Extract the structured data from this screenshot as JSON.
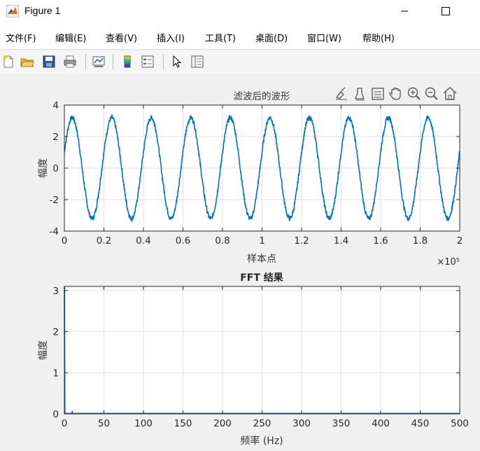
{
  "window": {
    "title": "Figure 1"
  },
  "menu": [
    "文件(F)",
    "编辑(E)",
    "查看(V)",
    "插入(I)",
    "工具(T)",
    "桌面(D)",
    "窗口(W)",
    "帮助(H)"
  ],
  "toolbar": [
    "new-figure-icon",
    "open-icon",
    "save-icon",
    "print-icon",
    "link-plot-icon",
    "colorbar-icon",
    "legend-icon",
    "pointer-icon",
    "property-inspector-icon"
  ],
  "axes_toolbar": [
    "brush-icon",
    "data-tips-icon",
    "rotate-icon",
    "pan-icon",
    "zoom-in-icon",
    "zoom-out-icon",
    "home-icon"
  ],
  "chart_data": [
    {
      "type": "line",
      "title": "滤波后的波形",
      "xlabel": "样本点",
      "ylabel": "幅度",
      "x_multiplier": "×10⁵",
      "xlim": [
        0,
        2
      ],
      "ylim": [
        -4,
        4
      ],
      "xticks": [
        "0",
        "0.2",
        "0.4",
        "0.6",
        "0.8",
        "1",
        "1.2",
        "1.4",
        "1.6",
        "1.8",
        "2"
      ],
      "yticks": [
        "-4",
        "-2",
        "0",
        "2",
        "4"
      ],
      "grid": true,
      "color": "#0072bd",
      "series": [
        {
          "cycles": 10,
          "amplitude": 3.2,
          "start_value": 1.0
        }
      ]
    },
    {
      "type": "line",
      "title": "FFT 结果",
      "xlabel": "频率 (Hz)",
      "ylabel": "幅度",
      "xlim": [
        0,
        500
      ],
      "ylim": [
        0,
        3.1
      ],
      "xticks": [
        "0",
        "50",
        "100",
        "150",
        "200",
        "250",
        "300",
        "350",
        "400",
        "450",
        "500"
      ],
      "yticks": [
        "0",
        "1",
        "2",
        "3"
      ],
      "grid": true,
      "color": "#0072bd",
      "series": [
        {
          "peaks": [
            [
              0,
              3.1
            ],
            [
              10,
              0.05
            ]
          ],
          "floor": 0.01
        }
      ]
    }
  ]
}
